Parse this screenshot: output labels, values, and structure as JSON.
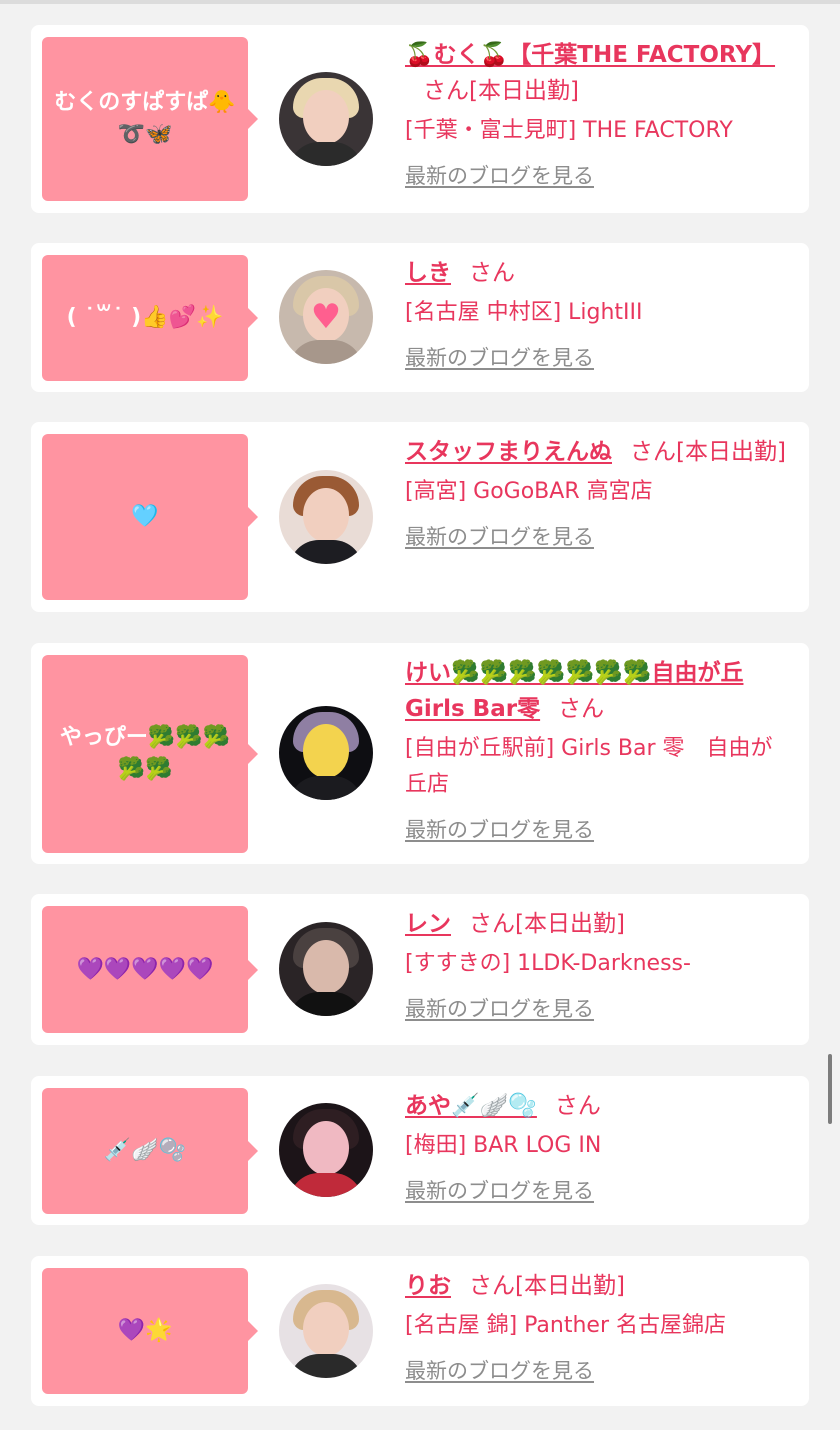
{
  "entries": [
    {
      "message": "むくのすぱすぱ🐥➰🦋",
      "name": "🍒むく🍒【千葉THE FACTORY】",
      "suffix": "さん[本日出勤]",
      "shop": "[千葉・富士見町] THE FACTORY",
      "blog_link": "最新のブログを見る",
      "avatar_icon": "portrait-blonde"
    },
    {
      "message": "( ˙꒳˙ )👍💕✨",
      "name": "しき",
      "suffix": "さん",
      "shop": "[名古屋 中村区] LightIII",
      "blog_link": "最新のブログを見る",
      "avatar_icon": "portrait-heart-sticker"
    },
    {
      "message": "🩵",
      "name": "スタッフまりえんぬ",
      "suffix": "さん[本日出勤]",
      "shop": "[高宮] GoGoBAR 高宮店",
      "blog_link": "最新のブログを見る",
      "avatar_icon": "portrait-auburn"
    },
    {
      "message": "やっぴー🥦🥦🥦🥦🥦",
      "name": "けい🥦🥦🥦🥦🥦🥦🥦自由が丘Girls Bar零",
      "suffix": "さん",
      "shop": "[自由が丘駅前] Girls Bar 零　自由が丘店",
      "blog_link": "最新のブログを見る",
      "avatar_icon": "portrait-yellow-mask"
    },
    {
      "message": "💜💜💜💜💜",
      "name": "レン",
      "suffix": "さん[本日出勤]",
      "shop": "[すすきの] 1LDK-Darkness-",
      "blog_link": "最新のブログを見る",
      "avatar_icon": "portrait-dark"
    },
    {
      "message": "💉🪽🫧",
      "name": "あや💉🪽🫧",
      "suffix": "さん",
      "shop": "[梅田] BAR LOG IN",
      "blog_link": "最新のブログを見る",
      "avatar_icon": "portrait-pink-bow"
    },
    {
      "message": "💜🌟",
      "name": "りお",
      "suffix": "さん[本日出勤]",
      "shop": "[名古屋 錦] Panther 名古屋錦店",
      "blog_link": "最新のブログを見る",
      "avatar_icon": "portrait-cat-ears"
    }
  ],
  "colors": {
    "accent": "#e8365d",
    "bubble": "#ff94a1",
    "link_gray": "#8d8d8d",
    "background": "#f2f2f2"
  }
}
